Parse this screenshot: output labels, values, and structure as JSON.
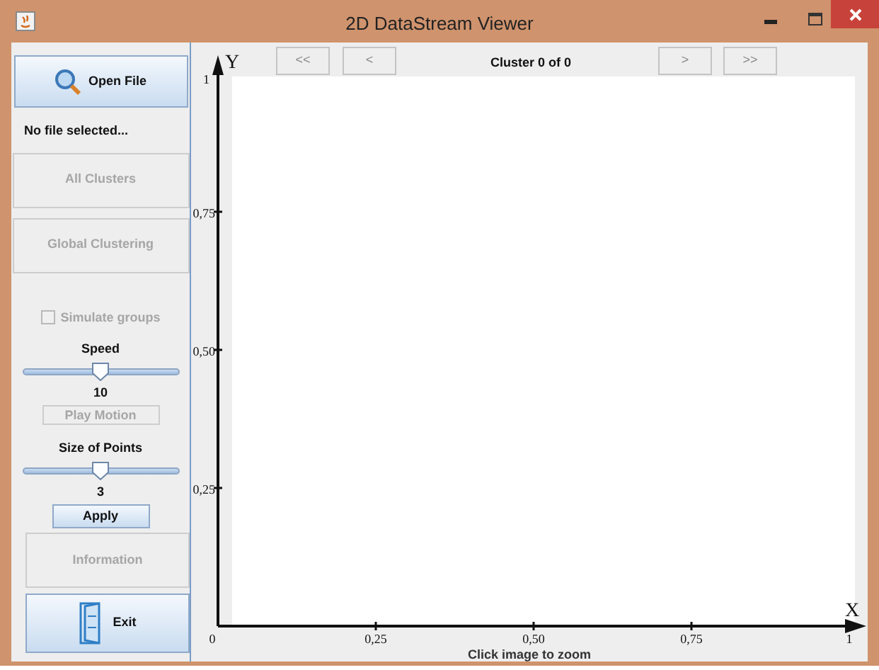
{
  "window": {
    "title": "2D DataStream Viewer"
  },
  "sidebar": {
    "open_button": "Open File",
    "file_status": "No file selected...",
    "buttons": [
      {
        "label": "All Clusters",
        "disabled": true
      },
      {
        "label": "Global Clustering",
        "disabled": true
      }
    ],
    "simulate_groups": {
      "label": "Simulate groups",
      "checked": false,
      "disabled": true
    },
    "speed": {
      "label": "Speed",
      "level": 0.5,
      "reading": "10"
    },
    "play_button": {
      "label": "Play Motion",
      "disabled": true
    },
    "point_size": {
      "label": "Size of Points",
      "level": 0.5,
      "reading": "3"
    },
    "apply_button": "Apply",
    "info_button": {
      "label": "Information",
      "disabled": true
    },
    "exit_button": "Exit"
  },
  "navigation": {
    "first": "<<",
    "previous": "<",
    "status": "Cluster 0 of 0",
    "next": ">",
    "last": ">>"
  },
  "plot": {
    "y_axis": "Y",
    "x_axis": "X",
    "yticks": [
      "1",
      "0,75",
      "0,50",
      "0,25"
    ],
    "xticks": [
      "0",
      "0,25",
      "0,50",
      "0,75",
      "1"
    ],
    "caption": "Click image to zoom"
  }
}
